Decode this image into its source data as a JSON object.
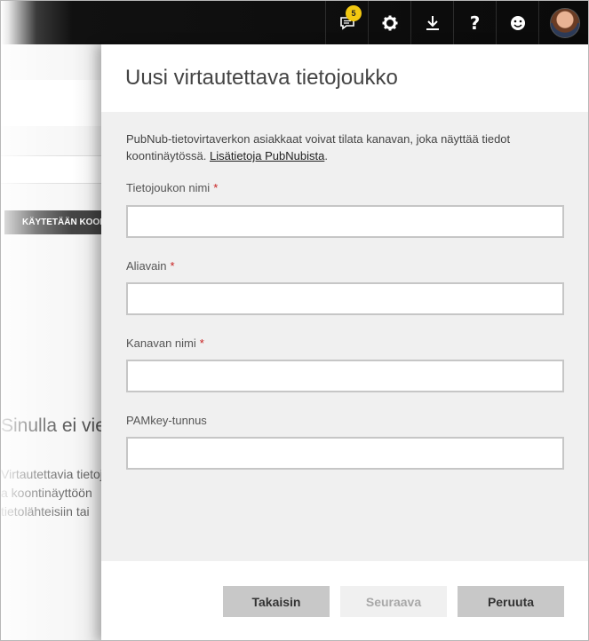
{
  "topbar": {
    "notification_count": "5",
    "icons": [
      "chat-notification-icon",
      "gear-icon",
      "download-icon",
      "help-icon",
      "smiley-icon",
      "avatar"
    ]
  },
  "background": {
    "tab_label": "KÄYTETÄÄN KOONTINÄYTTÖJÄ",
    "heading": "Sinulla ei vielä",
    "lines": [
      "Virtautettavia tietojoukkoja",
      "a koontinäyttöön",
      "tietolähteisiin tai"
    ]
  },
  "panel": {
    "title": "Uusi virtautettava tietojoukko",
    "description": "PubNub-tietovirtaverkon asiakkaat voivat tilata kanavan, joka näyttää tiedot koontinäytössä.",
    "link_text": "Lisätietoja PubNubista",
    "fields": [
      {
        "label": "Tietojoukon nimi",
        "required": "*",
        "value": ""
      },
      {
        "label": "Aliavain",
        "required": "*",
        "value": ""
      },
      {
        "label": "Kanavan nimi",
        "required": "*",
        "value": ""
      },
      {
        "label": "PAMkey-tunnus",
        "required": "",
        "value": ""
      }
    ],
    "buttons": {
      "back": "Takaisin",
      "next": "Seuraava",
      "cancel": "Peruuta"
    }
  },
  "colors": {
    "accent_badge": "#f2c811",
    "required": "#c81e1e",
    "button_bg": "#c8c8c8"
  }
}
